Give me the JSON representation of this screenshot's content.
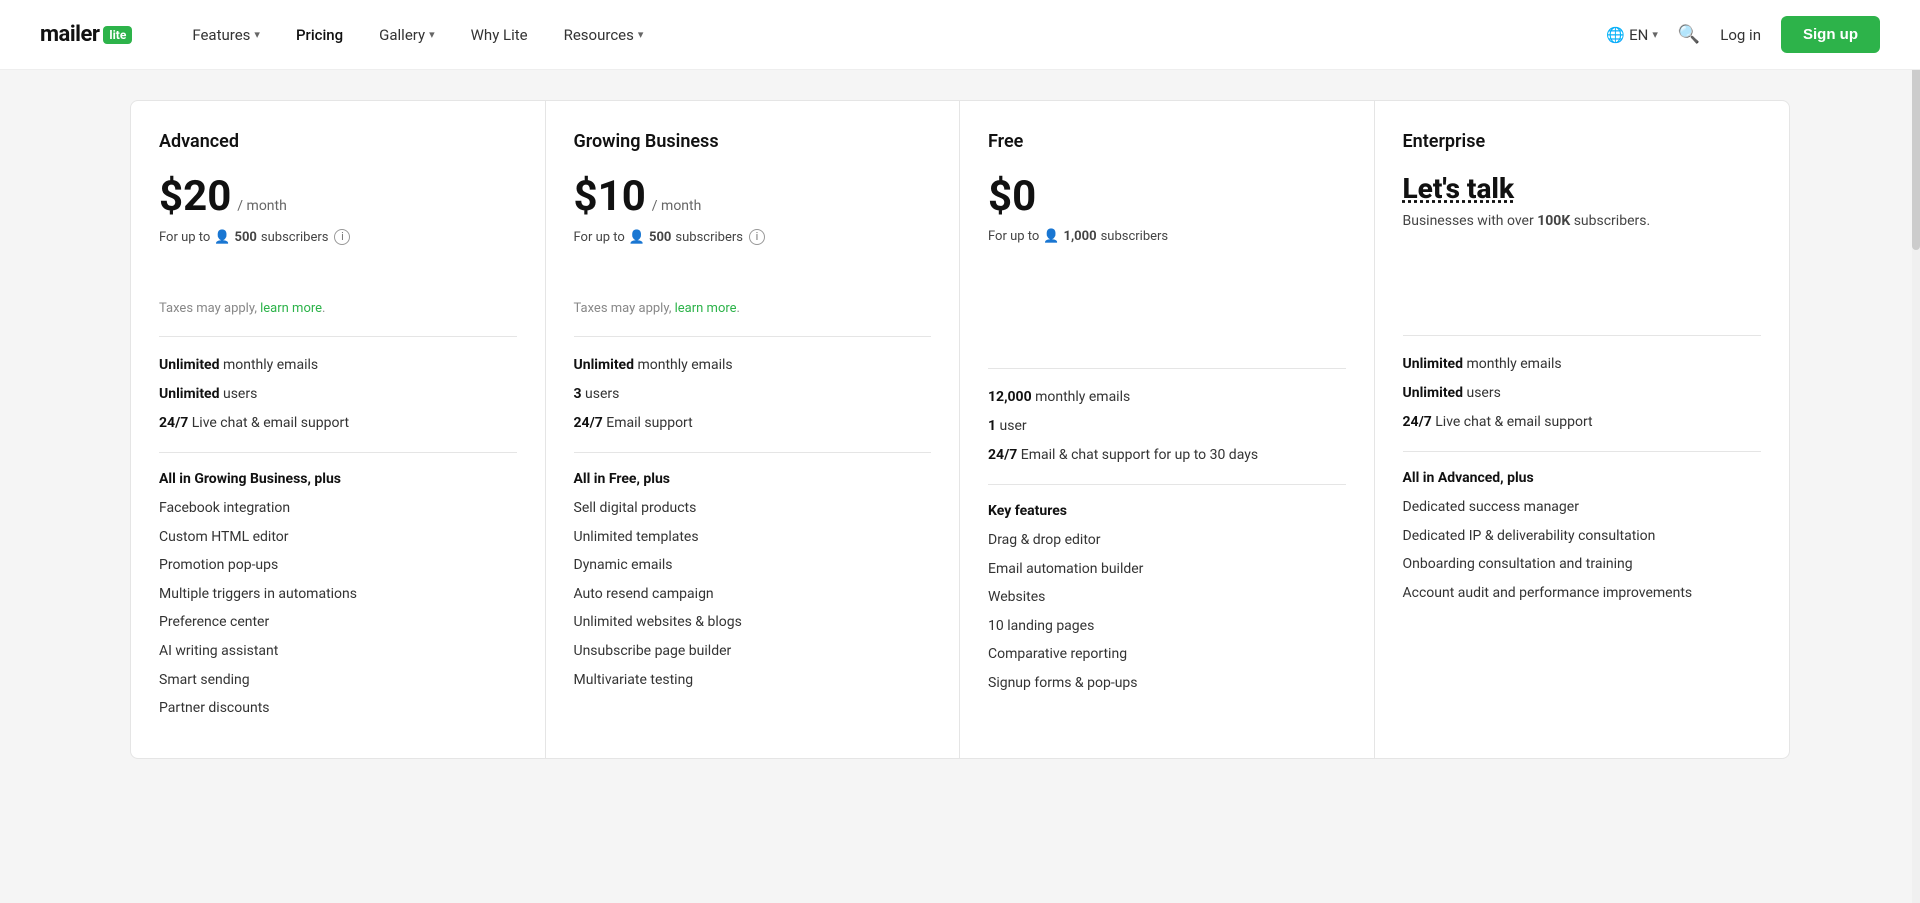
{
  "nav": {
    "logo_text": "mailer",
    "logo_badge": "lite",
    "links": [
      {
        "label": "Features",
        "has_dropdown": true
      },
      {
        "label": "Pricing",
        "has_dropdown": false
      },
      {
        "label": "Gallery",
        "has_dropdown": true
      },
      {
        "label": "Why Lite",
        "has_dropdown": false
      },
      {
        "label": "Resources",
        "has_dropdown": true
      }
    ],
    "lang": "EN",
    "login_label": "Log in",
    "signup_label": "Sign up"
  },
  "plans": [
    {
      "id": "advanced",
      "name": "Advanced",
      "price": "$20",
      "period": "/ month",
      "subscribers_prefix": "For up to",
      "subscribers_count": "500",
      "subscribers_suffix": "subscribers",
      "taxes_note": "Taxes may apply,",
      "learn_more": "learn more",
      "features_summary": [
        {
          "bold": "Unlimited",
          "rest": " monthly emails"
        },
        {
          "bold": "Unlimited",
          "rest": " users"
        },
        {
          "bold": "24/7",
          "rest": " Live chat & email support"
        }
      ],
      "all_in": "All in Growing Business, plus",
      "feature_list": [
        "Facebook integration",
        "Custom HTML editor",
        "Promotion pop-ups",
        "Multiple triggers in automations",
        "Preference center",
        "AI writing assistant",
        "Smart sending",
        "Partner discounts"
      ]
    },
    {
      "id": "growing-business",
      "name": "Growing Business",
      "price": "$10",
      "period": "/ month",
      "subscribers_prefix": "For up to",
      "subscribers_count": "500",
      "subscribers_suffix": "subscribers",
      "taxes_note": "Taxes may apply,",
      "learn_more": "learn more",
      "features_summary": [
        {
          "bold": "Unlimited",
          "rest": " monthly emails"
        },
        {
          "bold": "3",
          "rest": " users"
        },
        {
          "bold": "24/7",
          "rest": " Email support"
        }
      ],
      "all_in": "All in Free, plus",
      "feature_list": [
        "Sell digital products",
        "Unlimited templates",
        "Dynamic emails",
        "Auto resend campaign",
        "Unlimited websites & blogs",
        "Unsubscribe page builder",
        "Multivariate testing"
      ]
    },
    {
      "id": "free",
      "name": "Free",
      "price": "$0",
      "period": "",
      "subscribers_prefix": "For up to",
      "subscribers_count": "1,000",
      "subscribers_suffix": "subscribers",
      "features_summary": [
        {
          "bold": "12,000",
          "rest": " monthly emails"
        },
        {
          "bold": "1",
          "rest": " user"
        },
        {
          "bold": "24/7",
          "rest": " Email & chat support for up to 30 days"
        }
      ],
      "key_features_title": "Key features",
      "feature_list": [
        "Drag & drop editor",
        "Email automation builder",
        "Websites",
        "10 landing pages",
        "Comparative reporting",
        "Signup forms & pop-ups"
      ]
    },
    {
      "id": "enterprise",
      "name": "Enterprise",
      "price_label": "Let's talk",
      "enterprise_desc_prefix": "Businesses with over",
      "enterprise_desc_bold": "100K",
      "enterprise_desc_suffix": "subscribers.",
      "features_summary": [
        {
          "bold": "Unlimited",
          "rest": " monthly emails"
        },
        {
          "bold": "Unlimited",
          "rest": " users"
        },
        {
          "bold": "24/7",
          "rest": " Live chat & email support"
        }
      ],
      "all_in": "All in Advanced, plus",
      "feature_list": [
        "Dedicated success manager",
        "Dedicated IP & deliverability consultation",
        "Onboarding consultation and training",
        "Account audit and performance improvements"
      ]
    }
  ]
}
